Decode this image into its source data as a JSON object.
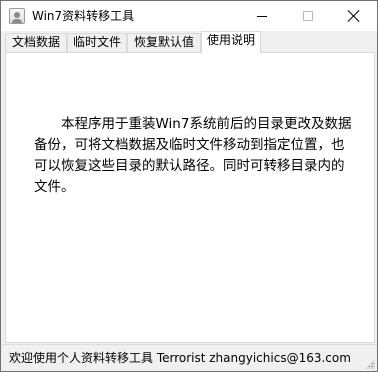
{
  "window": {
    "title": "Win7资料转移工具",
    "icon": "app-user-icon"
  },
  "controls": {
    "minimize_icon": "minimize-icon",
    "maximize_icon": "maximize-icon",
    "close_icon": "close-icon"
  },
  "tabs": [
    {
      "label": "文档数据",
      "active": false
    },
    {
      "label": "临时文件",
      "active": false
    },
    {
      "label": "恢复默认值",
      "active": false
    },
    {
      "label": "使用说明",
      "active": true
    }
  ],
  "content": {
    "description": "　　本程序用于重装Win7系统前后的目录更改及数据备份，可将文档数据及临时文件移动到指定位置，也可以恢复这些目录的默认路径。同时可转移目录内的文件。"
  },
  "statusbar": {
    "text": "欢迎使用个人资料转移工具  Terrorist  zhangyichics@163.com"
  },
  "colors": {
    "window_bg": "#f0f0f0",
    "content_bg": "#ffffff",
    "border": "#d9d9d9"
  }
}
